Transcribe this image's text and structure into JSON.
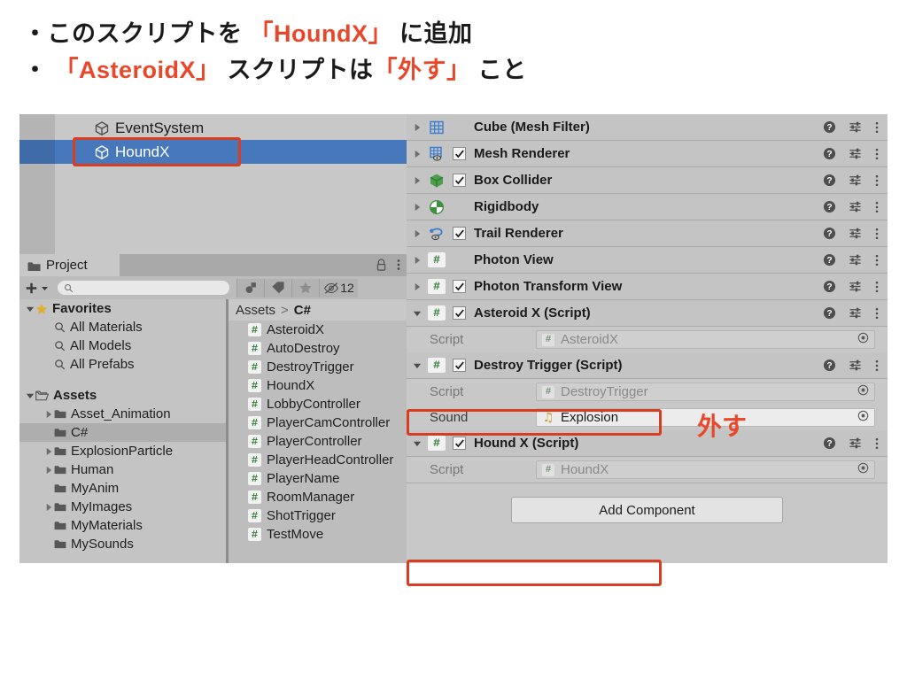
{
  "slide": {
    "bullets": [
      {
        "parts": [
          {
            "t": "・このスクリプトを ",
            "c": "dark"
          },
          {
            "t": "「HoundX」",
            "c": "accent"
          },
          {
            "t": " に追加",
            "c": "dark"
          }
        ]
      },
      {
        "parts": [
          {
            "t": "・ ",
            "c": "dark"
          },
          {
            "t": "「AsteroidX」",
            "c": "accent"
          },
          {
            "t": " スクリプトは",
            "c": "dark"
          },
          {
            "t": "「外す」",
            "c": "accent"
          },
          {
            "t": " こと",
            "c": "dark"
          }
        ]
      }
    ],
    "accent_color": "#e8472a",
    "text_color": "#1a1a1a"
  },
  "annotations": {
    "hazusu_label": "外す",
    "highlight_color": "#d93c1f"
  },
  "hierarchy": {
    "items": [
      {
        "name": "EventSystem",
        "selected": false,
        "icon": "cube-icon"
      },
      {
        "name": "HoundX",
        "selected": true,
        "icon": "cube-icon"
      }
    ],
    "selection_color": "#4878bc"
  },
  "project": {
    "tab_label": "Project",
    "tab_icons": [
      "lock-icon",
      "kebab-menu-icon"
    ],
    "toolbar": {
      "create_label": "+",
      "search_placeholder": "",
      "search_value": "",
      "filter_buttons": [
        "object-type-filter-icon",
        "label-filter-icon",
        "favorite-filter-icon"
      ],
      "hidden_toggle_icon": "eye-off-icon",
      "hidden_count": "12"
    },
    "tree": [
      {
        "label": "Favorites",
        "indent": 0,
        "bold": true,
        "triangle": "down",
        "icon": "star-icon",
        "selected": false
      },
      {
        "label": "All Materials",
        "indent": 1,
        "bold": false,
        "triangle": "none",
        "icon": "search-icon",
        "selected": false
      },
      {
        "label": "All Models",
        "indent": 1,
        "bold": false,
        "triangle": "none",
        "icon": "search-icon",
        "selected": false
      },
      {
        "label": "All Prefabs",
        "indent": 1,
        "bold": false,
        "triangle": "none",
        "icon": "search-icon",
        "selected": false
      },
      {
        "label": "Assets",
        "indent": 0,
        "bold": true,
        "triangle": "down",
        "icon": "folder-open-icon",
        "selected": false
      },
      {
        "label": "Asset_Animation",
        "indent": 1,
        "bold": false,
        "triangle": "right",
        "icon": "folder-icon",
        "selected": false
      },
      {
        "label": "C#",
        "indent": 1,
        "bold": false,
        "triangle": "none",
        "icon": "folder-icon",
        "selected": true
      },
      {
        "label": "ExplosionParticle",
        "indent": 1,
        "bold": false,
        "triangle": "right",
        "icon": "folder-icon",
        "selected": false
      },
      {
        "label": "Human",
        "indent": 1,
        "bold": false,
        "triangle": "right",
        "icon": "folder-icon",
        "selected": false
      },
      {
        "label": "MyAnim",
        "indent": 1,
        "bold": false,
        "triangle": "none",
        "icon": "folder-icon",
        "selected": false
      },
      {
        "label": "MyImages",
        "indent": 1,
        "bold": false,
        "triangle": "right",
        "icon": "folder-icon",
        "selected": false
      },
      {
        "label": "MyMaterials",
        "indent": 1,
        "bold": false,
        "triangle": "none",
        "icon": "folder-icon",
        "selected": false
      },
      {
        "label": "MySounds",
        "indent": 1,
        "bold": false,
        "triangle": "none",
        "icon": "folder-icon",
        "selected": false
      }
    ],
    "breadcrumb": {
      "root": "Assets",
      "separator": ">",
      "current": "C#"
    },
    "files": [
      {
        "name": "AsteroidX",
        "icon": "csharp-script-icon"
      },
      {
        "name": "AutoDestroy",
        "icon": "csharp-script-icon"
      },
      {
        "name": "DestroyTrigger",
        "icon": "csharp-script-icon"
      },
      {
        "name": "HoundX",
        "icon": "csharp-script-icon"
      },
      {
        "name": "LobbyController",
        "icon": "csharp-script-icon"
      },
      {
        "name": "PlayerCamController",
        "icon": "csharp-script-icon"
      },
      {
        "name": "PlayerController",
        "icon": "csharp-script-icon"
      },
      {
        "name": "PlayerHeadController",
        "icon": "csharp-script-icon"
      },
      {
        "name": "PlayerName",
        "icon": "csharp-script-icon"
      },
      {
        "name": "RoomManager",
        "icon": "csharp-script-icon"
      },
      {
        "name": "ShotTrigger",
        "icon": "csharp-script-icon"
      },
      {
        "name": "TestMove",
        "icon": "csharp-script-icon"
      }
    ]
  },
  "inspector": {
    "components": [
      {
        "title": "Cube (Mesh Filter)",
        "icon": "mesh-filter-icon",
        "expanded": false,
        "has_checkbox": false,
        "checked": false,
        "highlighted": false
      },
      {
        "title": "Mesh Renderer",
        "icon": "mesh-renderer-icon",
        "expanded": false,
        "has_checkbox": true,
        "checked": true,
        "highlighted": false
      },
      {
        "title": "Box Collider",
        "icon": "box-collider-icon",
        "expanded": false,
        "has_checkbox": true,
        "checked": true,
        "highlighted": false
      },
      {
        "title": "Rigidbody",
        "icon": "rigidbody-icon",
        "expanded": false,
        "has_checkbox": false,
        "checked": false,
        "highlighted": false
      },
      {
        "title": "Trail Renderer",
        "icon": "trail-renderer-icon",
        "expanded": false,
        "has_checkbox": true,
        "checked": true,
        "highlighted": false
      },
      {
        "title": "Photon View",
        "icon": "csharp-script-icon",
        "expanded": false,
        "has_checkbox": false,
        "checked": false,
        "highlighted": false
      },
      {
        "title": "Photon Transform View",
        "icon": "csharp-script-icon",
        "expanded": false,
        "has_checkbox": true,
        "checked": true,
        "highlighted": false
      },
      {
        "title": "Asteroid X (Script)",
        "icon": "csharp-script-icon",
        "expanded": true,
        "has_checkbox": true,
        "checked": true,
        "highlighted": true,
        "properties": [
          {
            "label": "Script",
            "label_dim": true,
            "value": "AsteroidX",
            "value_dim": true,
            "field_icon": "csharp-script-icon",
            "readonly": true
          }
        ]
      },
      {
        "title": "Destroy Trigger (Script)",
        "icon": "csharp-script-icon",
        "expanded": true,
        "has_checkbox": true,
        "checked": true,
        "highlighted": false,
        "properties": [
          {
            "label": "Script",
            "label_dim": true,
            "value": "DestroyTrigger",
            "value_dim": true,
            "field_icon": "csharp-script-icon",
            "readonly": true
          },
          {
            "label": "Sound",
            "label_dim": false,
            "value": "Explosion",
            "value_dim": false,
            "field_icon": "audio-clip-icon",
            "readonly": false
          }
        ]
      },
      {
        "title": "Hound X (Script)",
        "icon": "csharp-script-icon",
        "expanded": true,
        "has_checkbox": true,
        "checked": true,
        "highlighted": true,
        "properties": [
          {
            "label": "Script",
            "label_dim": true,
            "value": "HoundX",
            "value_dim": true,
            "field_icon": "csharp-script-icon",
            "readonly": true
          }
        ]
      }
    ],
    "row_icons": [
      "help-icon",
      "preset-icon",
      "kebab-menu-icon"
    ],
    "add_component_label": "Add Component"
  }
}
